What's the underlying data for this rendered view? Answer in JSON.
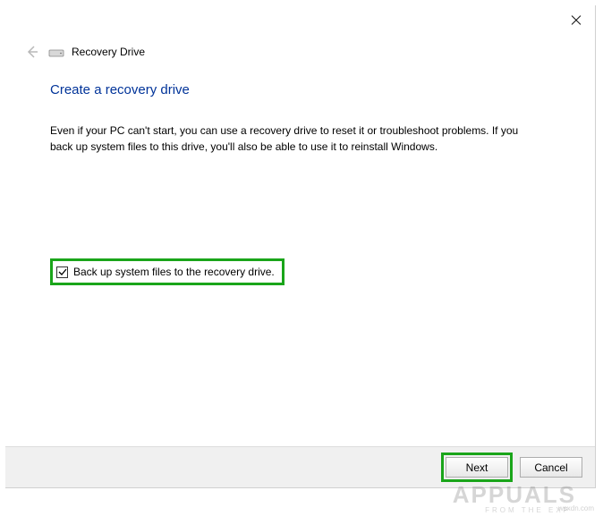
{
  "header": {
    "title": "Recovery Drive"
  },
  "content": {
    "heading": "Create a recovery drive",
    "description": "Even if your PC can't start, you can use a recovery drive to reset it or troubleshoot problems. If you back up system files to this drive, you'll also be able to use it to reinstall Windows."
  },
  "checkbox": {
    "label": "Back up system files to the recovery drive.",
    "checked": true
  },
  "footer": {
    "next_label": "Next",
    "cancel_label": "Cancel"
  },
  "watermark": {
    "main": "APPUALS",
    "sub": "FROM THE EXP",
    "site": "wsxdn.com"
  }
}
